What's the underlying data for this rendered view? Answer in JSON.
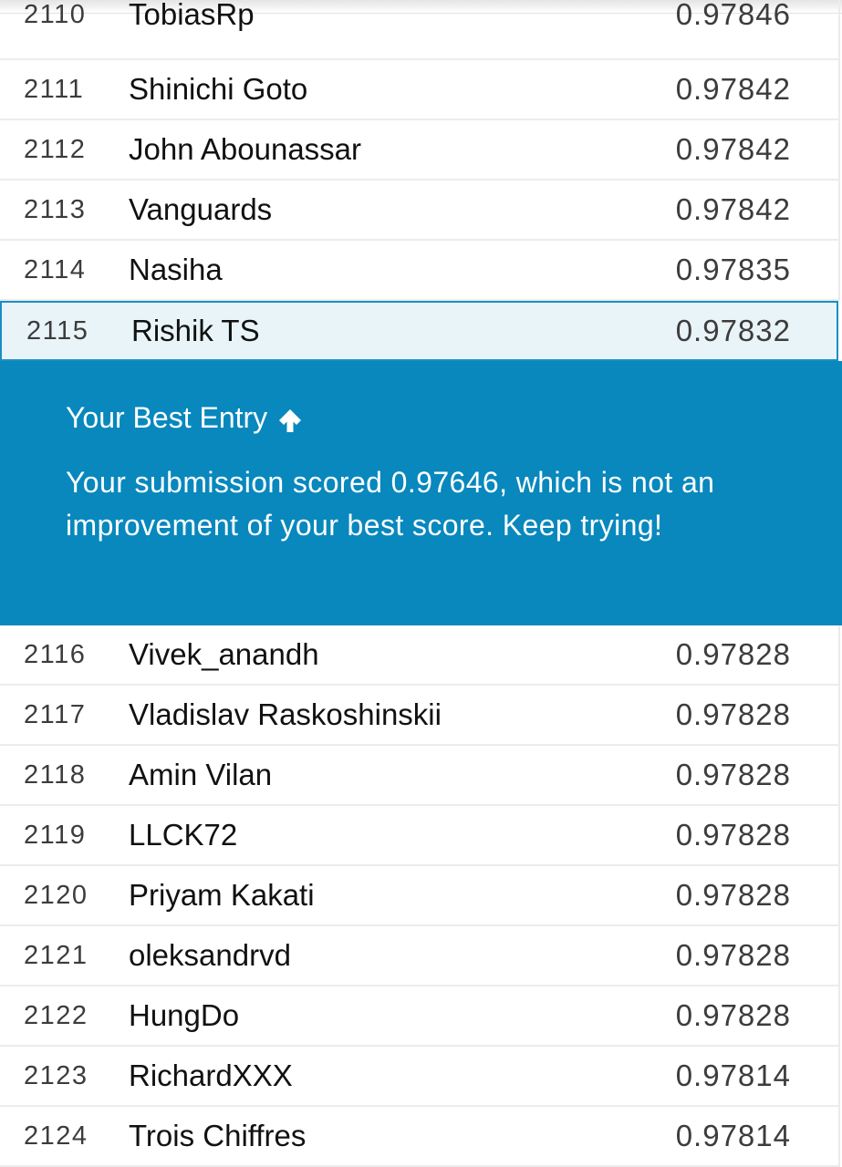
{
  "leaderboard": {
    "rows_before": [
      {
        "rank": "2110",
        "name": "TobiasRp",
        "score": "0.97846"
      },
      {
        "rank": "2111",
        "name": "Shinichi Goto",
        "score": "0.97842"
      },
      {
        "rank": "2112",
        "name": "John Abounassar",
        "score": "0.97842"
      },
      {
        "rank": "2113",
        "name": "Vanguards",
        "score": "0.97842"
      },
      {
        "rank": "2114",
        "name": "Nasiha",
        "score": "0.97835"
      }
    ],
    "current_user": {
      "rank": "2115",
      "name": "Rishik TS",
      "score": "0.97832"
    },
    "rows_after": [
      {
        "rank": "2116",
        "name": "Vivek_anandh",
        "score": "0.97828"
      },
      {
        "rank": "2117",
        "name": "Vladislav Raskoshinskii",
        "score": "0.97828"
      },
      {
        "rank": "2118",
        "name": "Amin Vilan",
        "score": "0.97828"
      },
      {
        "rank": "2119",
        "name": "LLCK72",
        "score": "0.97828"
      },
      {
        "rank": "2120",
        "name": "Priyam Kakati",
        "score": "0.97828"
      },
      {
        "rank": "2121",
        "name": "oleksandrvd",
        "score": "0.97828"
      },
      {
        "rank": "2122",
        "name": "HungDo",
        "score": "0.97828"
      },
      {
        "rank": "2123",
        "name": "RichardXXX",
        "score": "0.97814"
      },
      {
        "rank": "2124",
        "name": "Trois Chiffres",
        "score": "0.97814"
      }
    ]
  },
  "best_entry": {
    "title": "Your Best Entry",
    "icon": "arrow-up-icon",
    "message": "Your submission scored 0.97646, which is not an improvement of your best score. Keep trying!"
  },
  "colors": {
    "banner_background": "#0888bd",
    "highlight_border": "#1a8fc4",
    "highlight_background": "#e8f4f8"
  }
}
